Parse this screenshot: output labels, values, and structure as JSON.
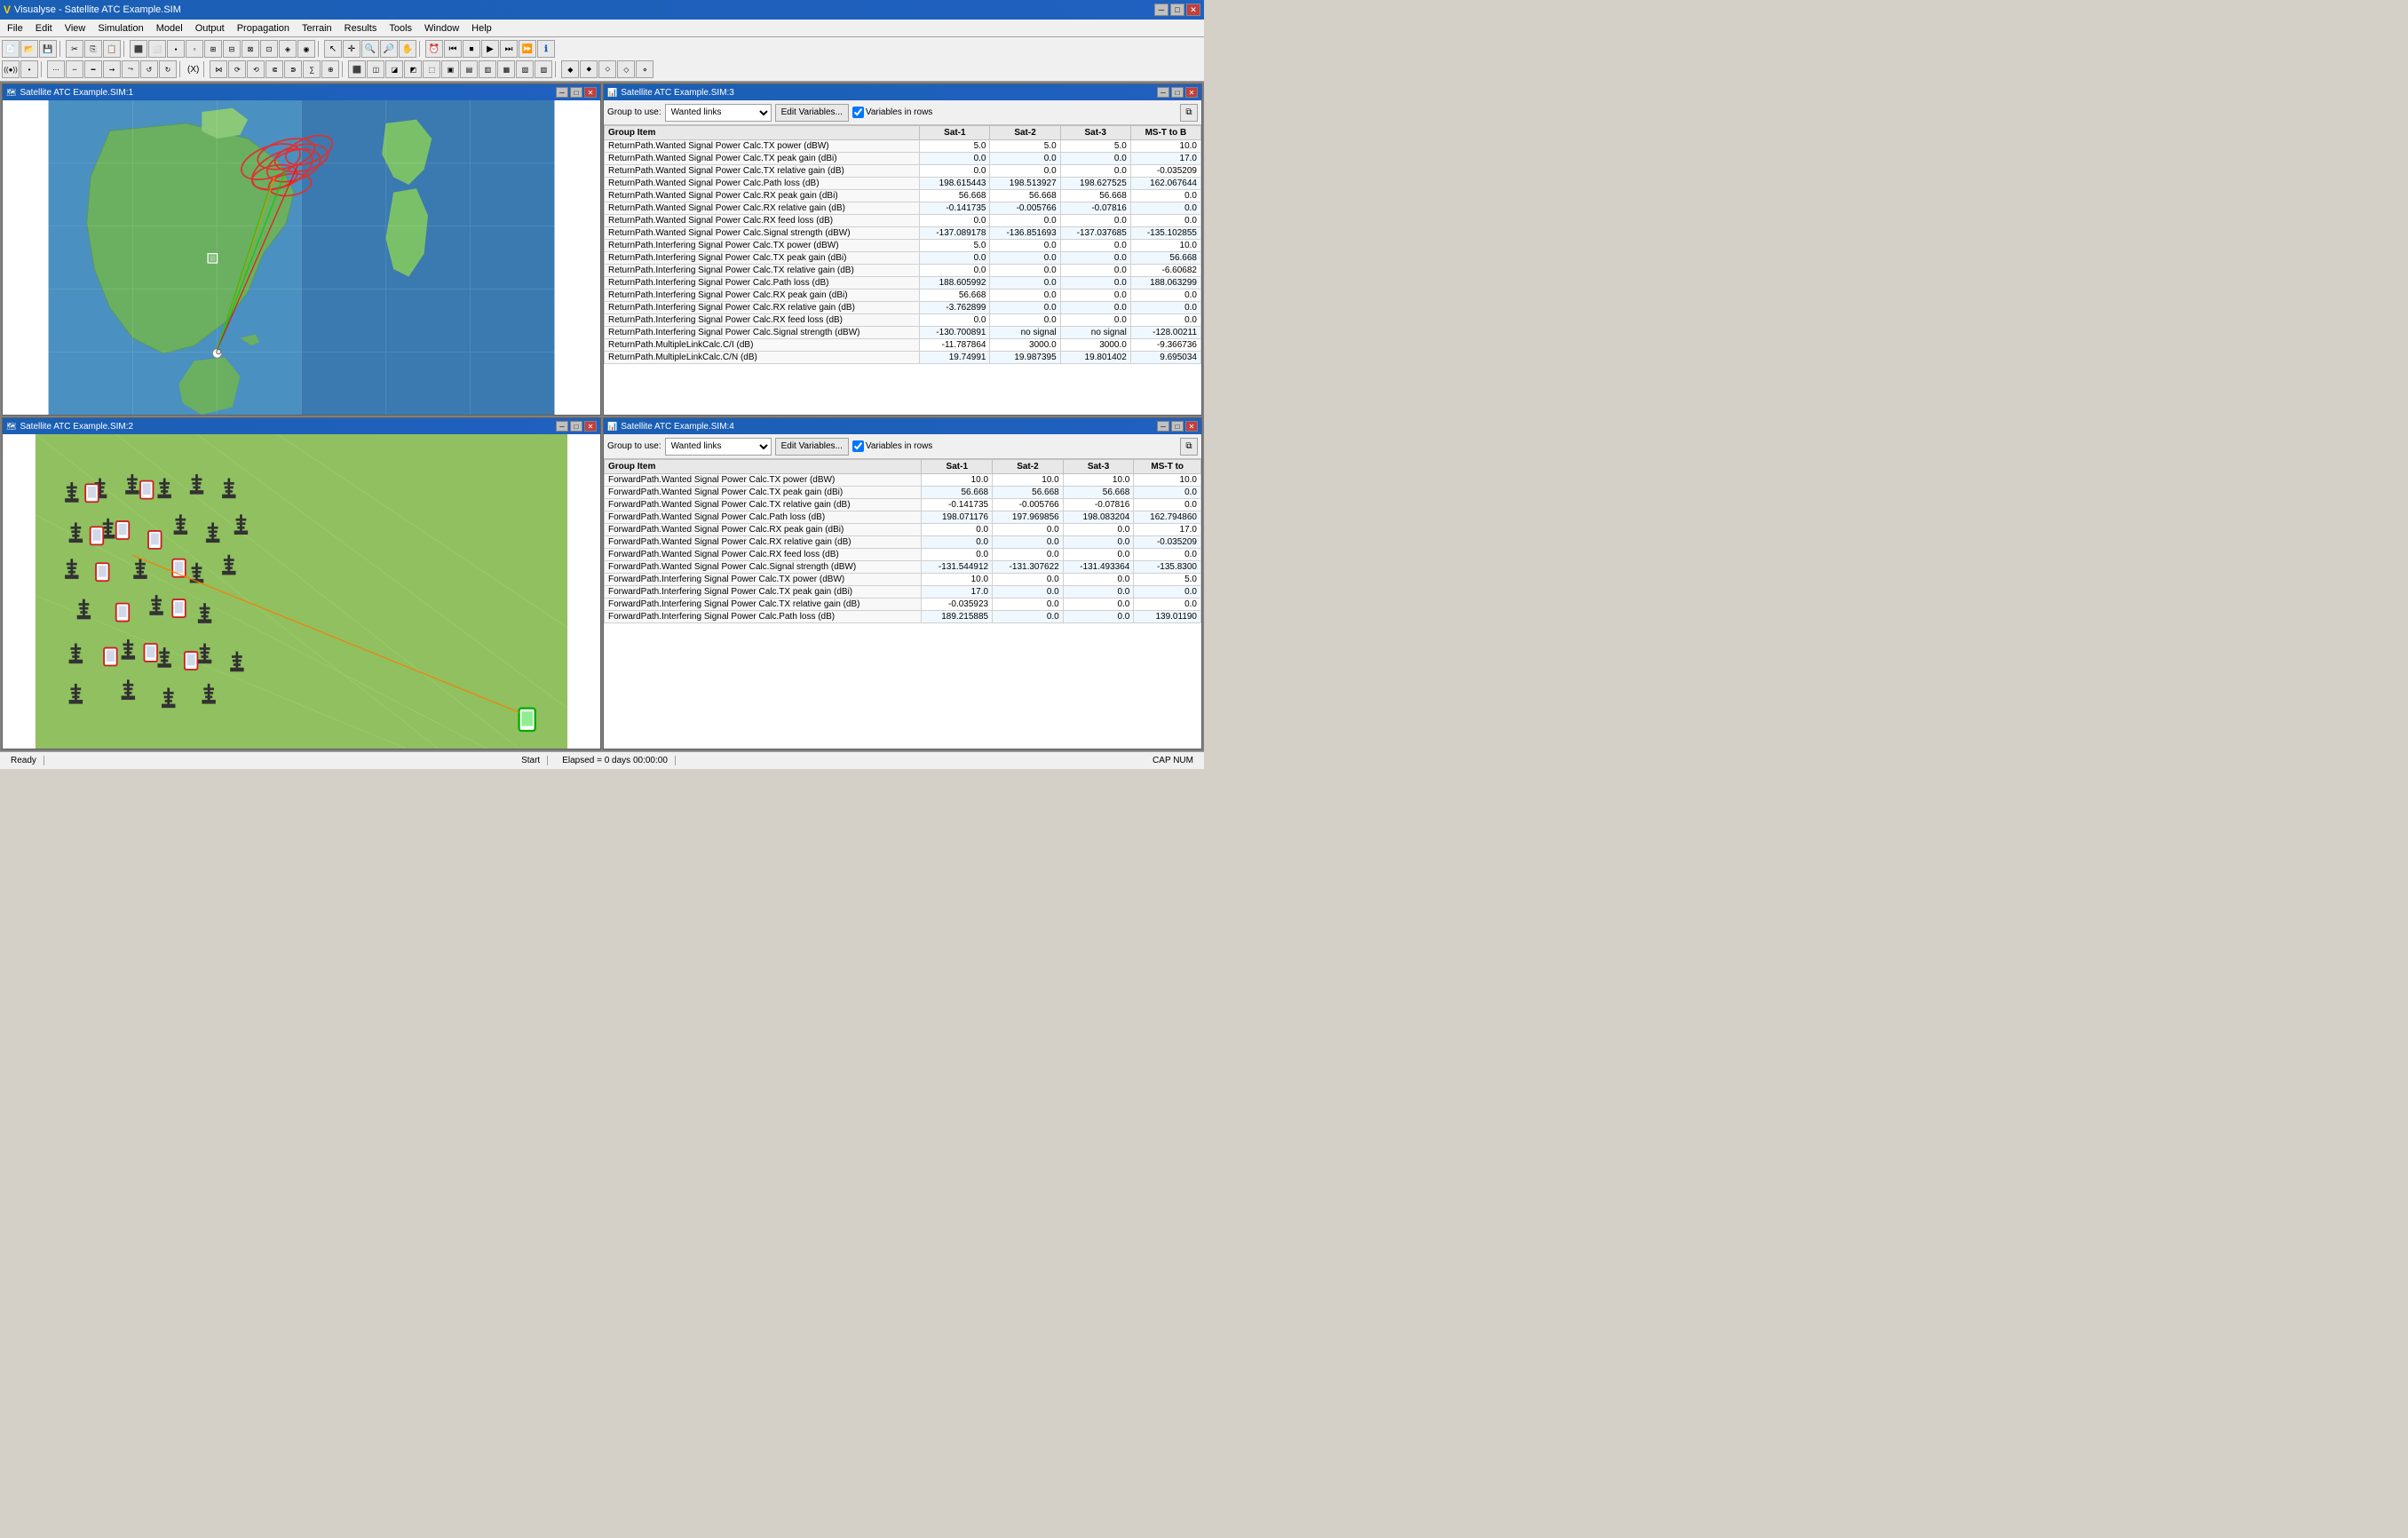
{
  "app": {
    "title": "Visualyse - Satellite ATC Example.SIM",
    "logo": "V"
  },
  "menu": {
    "items": [
      "File",
      "Edit",
      "View",
      "Simulation",
      "Model",
      "Output",
      "Propagation",
      "Terrain",
      "Results",
      "Tools",
      "Window",
      "Help"
    ]
  },
  "panels": {
    "sim1": {
      "title": "Satellite ATC Example.SIM:1",
      "type": "map"
    },
    "sim2": {
      "title": "Satellite ATC Example.SIM:2",
      "type": "map_green"
    },
    "sim3": {
      "title": "Satellite ATC Example.SIM:3",
      "type": "table",
      "group_label": "Group to use:",
      "group_value": "Wanted links",
      "edit_btn": "Edit Variables...",
      "variables_in_rows": true,
      "variables_label": "Variables in rows",
      "columns": [
        "Group Item",
        "Sat-1",
        "Sat-2",
        "Sat-3",
        "MS-T to B"
      ],
      "rows": [
        [
          "ReturnPath.Wanted Signal Power Calc.TX power (dBW)",
          "5.0",
          "5.0",
          "5.0",
          "10.0"
        ],
        [
          "ReturnPath.Wanted Signal Power Calc.TX peak gain (dBi)",
          "0.0",
          "0.0",
          "0.0",
          "17.0"
        ],
        [
          "ReturnPath.Wanted Signal Power Calc.TX relative gain (dB)",
          "0.0",
          "0.0",
          "0.0",
          "-0.035209"
        ],
        [
          "ReturnPath.Wanted Signal Power Calc.Path loss (dB)",
          "198.615443",
          "198.513927",
          "198.627525",
          "162.067644"
        ],
        [
          "ReturnPath.Wanted Signal Power Calc.RX peak gain (dBi)",
          "56.668",
          "56.668",
          "56.668",
          "0.0"
        ],
        [
          "ReturnPath.Wanted Signal Power Calc.RX relative gain (dB)",
          "-0.141735",
          "-0.005766",
          "-0.07816",
          "0.0"
        ],
        [
          "ReturnPath.Wanted Signal Power Calc.RX feed loss (dB)",
          "0.0",
          "0.0",
          "0.0",
          "0.0"
        ],
        [
          "ReturnPath.Wanted Signal Power Calc.Signal strength (dBW)",
          "-137.089178",
          "-136.851693",
          "-137.037685",
          "-135.102855"
        ],
        [
          "ReturnPath.Interfering Signal Power Calc.TX power (dBW)",
          "5.0",
          "0.0",
          "0.0",
          "10.0"
        ],
        [
          "ReturnPath.Interfering Signal Power Calc.TX peak gain (dBi)",
          "0.0",
          "0.0",
          "0.0",
          "56.668"
        ],
        [
          "ReturnPath.Interfering Signal Power Calc.TX relative gain (dB)",
          "0.0",
          "0.0",
          "0.0",
          "-6.60682"
        ],
        [
          "ReturnPath.Interfering Signal Power Calc.Path loss (dB)",
          "188.605992",
          "0.0",
          "0.0",
          "188.063299"
        ],
        [
          "ReturnPath.Interfering Signal Power Calc.RX peak gain (dBi)",
          "56.668",
          "0.0",
          "0.0",
          "0.0"
        ],
        [
          "ReturnPath.Interfering Signal Power Calc.RX relative gain (dB)",
          "-3.762899",
          "0.0",
          "0.0",
          "0.0"
        ],
        [
          "ReturnPath.Interfering Signal Power Calc.RX feed loss (dB)",
          "0.0",
          "0.0",
          "0.0",
          "0.0"
        ],
        [
          "ReturnPath.Interfering Signal Power Calc.Signal strength (dBW)",
          "-130.700891",
          "no signal",
          "no signal",
          "-128.00211"
        ],
        [
          "ReturnPath.MultipleLinkCalc.C/I (dB)",
          "-11.787864",
          "3000.0",
          "3000.0",
          "-9.366736"
        ],
        [
          "ReturnPath.MultipleLinkCalc.C/N (dB)",
          "19.74991",
          "19.987395",
          "19.801402",
          "9.695034"
        ]
      ]
    },
    "sim4": {
      "title": "Satellite ATC Example.SIM:4",
      "type": "table",
      "group_label": "Group to use:",
      "group_value": "Wanted links",
      "edit_btn": "Edit Variables...",
      "variables_in_rows": true,
      "variables_label": "Variables in rows",
      "columns": [
        "Group Item",
        "Sat-1",
        "Sat-2",
        "Sat-3",
        "MS-T to"
      ],
      "rows": [
        [
          "ForwardPath.Wanted Signal Power Calc.TX power (dBW)",
          "10.0",
          "10.0",
          "10.0",
          "10.0"
        ],
        [
          "ForwardPath.Wanted Signal Power Calc.TX peak gain (dBi)",
          "56.668",
          "56.668",
          "56.668",
          "0.0"
        ],
        [
          "ForwardPath.Wanted Signal Power Calc.TX relative gain (dB)",
          "-0.141735",
          "-0.005766",
          "-0.07816",
          "0.0"
        ],
        [
          "ForwardPath.Wanted Signal Power Calc.Path loss (dB)",
          "198.071176",
          "197.969856",
          "198.083204",
          "162.794860"
        ],
        [
          "ForwardPath.Wanted Signal Power Calc.RX peak gain (dBi)",
          "0.0",
          "0.0",
          "0.0",
          "17.0"
        ],
        [
          "ForwardPath.Wanted Signal Power Calc.RX relative gain (dB)",
          "0.0",
          "0.0",
          "0.0",
          "-0.035209"
        ],
        [
          "ForwardPath.Wanted Signal Power Calc.RX feed loss (dB)",
          "0.0",
          "0.0",
          "0.0",
          "0.0"
        ],
        [
          "ForwardPath.Wanted Signal Power Calc.Signal strength (dBW)",
          "-131.544912",
          "-131.307622",
          "-131.493364",
          "-135.8300"
        ],
        [
          "ForwardPath.Interfering Signal Power Calc.TX power (dBW)",
          "10.0",
          "0.0",
          "0.0",
          "5.0"
        ],
        [
          "ForwardPath.Interfering Signal Power Calc.TX peak gain (dBi)",
          "17.0",
          "0.0",
          "0.0",
          "0.0"
        ],
        [
          "ForwardPath.Interfering Signal Power Calc.TX relative gain (dB)",
          "-0.035923",
          "0.0",
          "0.0",
          "0.0"
        ],
        [
          "ForwardPath.Interfering Signal Power Calc.Path loss (dB)",
          "189.215885",
          "0.0",
          "0.0",
          "139.01190"
        ]
      ]
    }
  },
  "status_bar": {
    "ready": "Ready",
    "start": "Start",
    "elapsed": "Elapsed = 0 days 00:00:00",
    "cap_num": "CAP NUM"
  }
}
